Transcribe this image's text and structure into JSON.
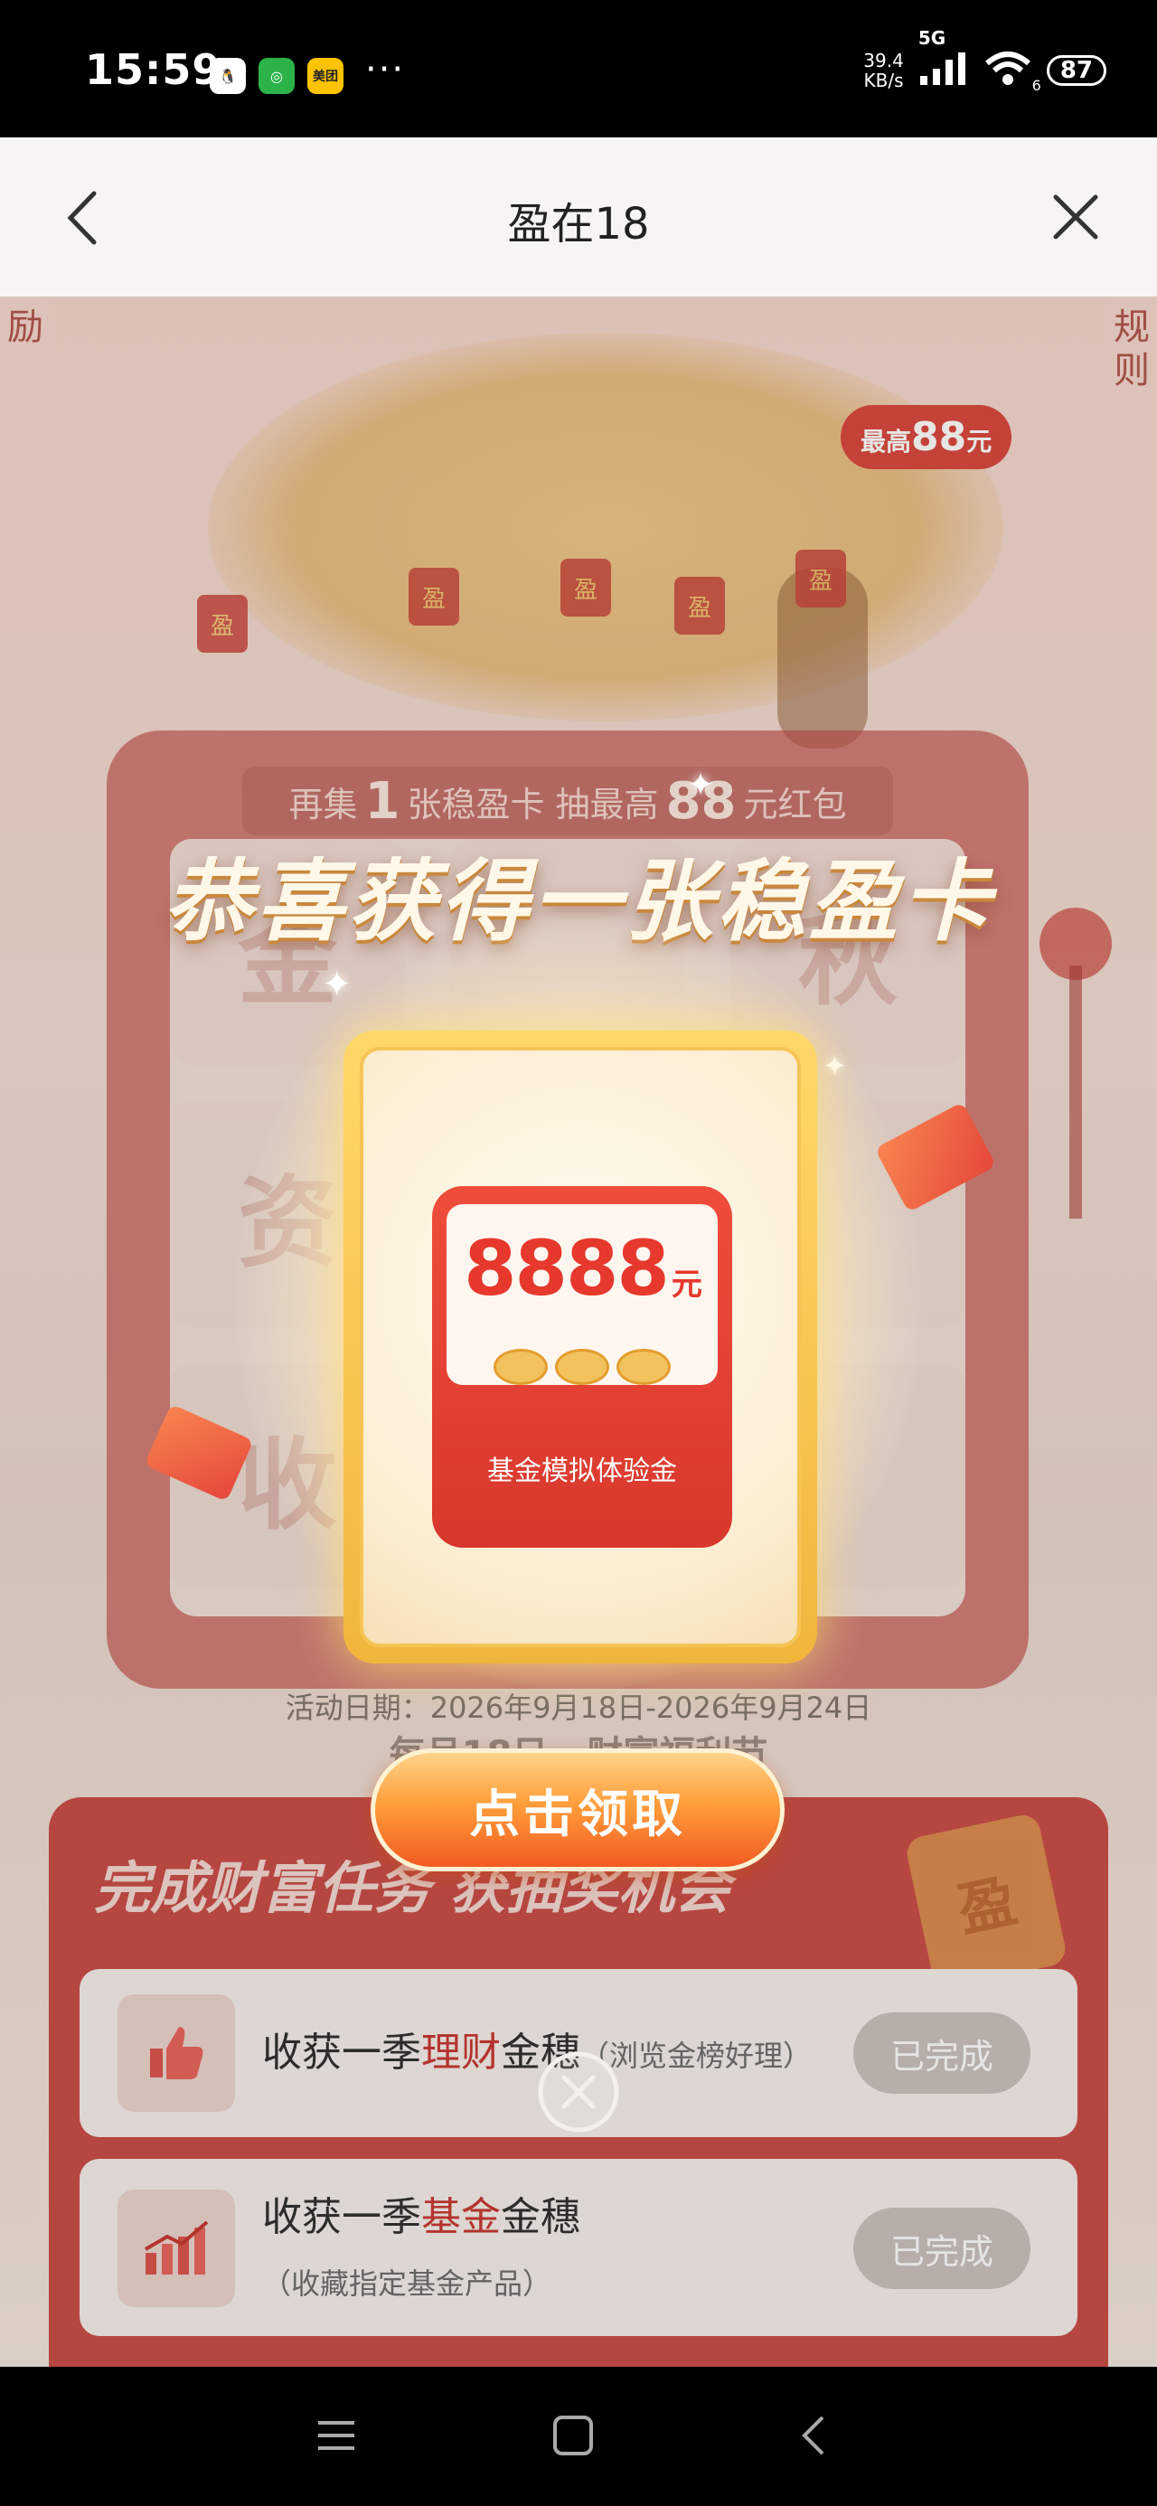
{
  "status": {
    "time": "15:59",
    "apps": [
      {
        "name": "qq-icon",
        "glyph": "🐧",
        "bg": "#ffffff",
        "fg": "#000000"
      },
      {
        "name": "wechat-icon",
        "glyph": "◎",
        "bg": "#2bb34a",
        "fg": "#ffffff"
      },
      {
        "name": "meituan-icon",
        "glyph": "美团",
        "bg": "#ffc300",
        "fg": "#222222"
      }
    ],
    "more": "···",
    "net_speed_value": "39.4",
    "net_speed_unit": "KB/s",
    "net_type": "5G",
    "wifi_sub": "6",
    "battery": "87"
  },
  "header": {
    "title": "盈在18"
  },
  "page": {
    "side_tag_left": "励",
    "side_tag_right": "规\n则",
    "hanging_tag_char": "盈",
    "promo_prefix": "最高",
    "promo_amount": "88",
    "promo_suffix": "元",
    "machine_header_prefix": "再集",
    "machine_header_count": "1",
    "machine_header_middle": "张稳盈卡 抽最高",
    "machine_header_amount": "88",
    "machine_header_suffix": "元红包",
    "slot_chars": [
      "金",
      "",
      "秋",
      "资",
      "",
      "",
      "收",
      "",
      ""
    ],
    "event_date": "活动日期：2026年9月18日-2026年9月24日",
    "subtitle": "每月18日 · 财富福利节",
    "task_panel_title": "完成财富任务 获抽奖机会",
    "panel_coin_char": "盈",
    "tasks": [
      {
        "text_prefix": "收获一季",
        "highlight": "理财",
        "text_suffix": "金穗",
        "note": "（浏览金榜好理）",
        "button": "已完成"
      },
      {
        "text_prefix": "收获一季",
        "highlight": "基金",
        "text_suffix": "金穗",
        "note": "（收藏指定基金产品）",
        "button": "已完成"
      }
    ]
  },
  "dialog": {
    "congrats": "恭喜获得一张稳盈卡",
    "amount": "8888",
    "amount_unit": "元",
    "card_label": "基金模拟体验金",
    "claim_button": "点击领取"
  },
  "colors": {
    "accent_red": "#c84b45",
    "gold": "#f2b53c",
    "claim_orange": "#f25b22",
    "completed_gray": "#c9c1bd"
  }
}
